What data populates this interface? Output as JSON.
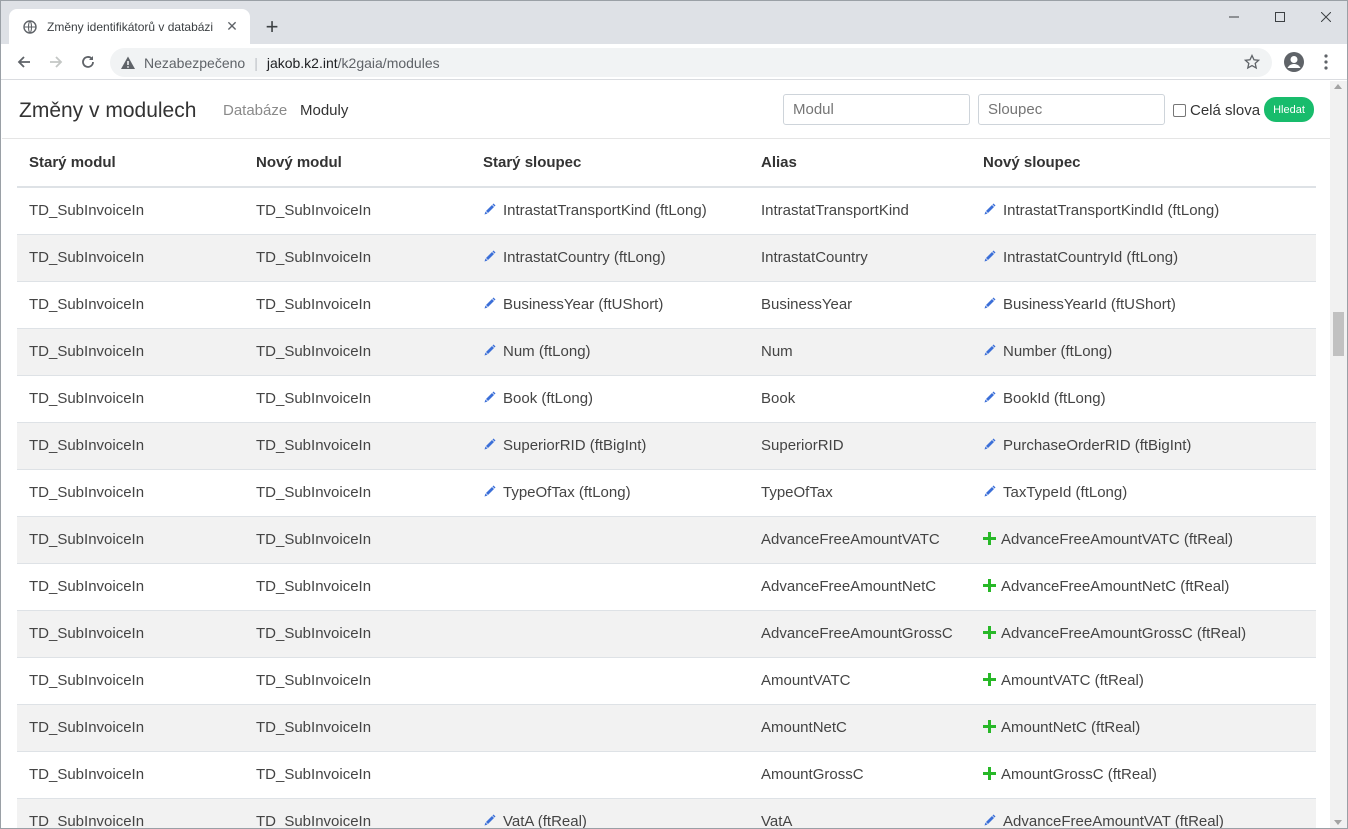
{
  "browser": {
    "tab_title": "Změny identifikátorů v databázi",
    "omnibox": {
      "security": "Nezabezpečeno",
      "host": "jakob.k2.int",
      "path": "/k2gaia/modules"
    }
  },
  "navbar": {
    "brand": "Změny v modulech",
    "links": {
      "databases": "Databáze",
      "modules": "Moduly"
    },
    "search_module_placeholder": "Modul",
    "search_column_placeholder": "Sloupec",
    "whole_words_label": "Celá slova",
    "search_button": "Hledat"
  },
  "table": {
    "headers": {
      "old_module": "Starý modul",
      "new_module": "Nový modul",
      "old_column": "Starý sloupec",
      "alias": "Alias",
      "new_column": "Nový sloupec"
    },
    "rows": [
      {
        "old_module": "TD_SubInvoiceIn",
        "new_module": "TD_SubInvoiceIn",
        "old_column": "IntrastatTransportKind (ftLong)",
        "alias": "IntrastatTransportKind",
        "new_column": "IntrastatTransportKindId (ftLong)",
        "change": "edit"
      },
      {
        "old_module": "TD_SubInvoiceIn",
        "new_module": "TD_SubInvoiceIn",
        "old_column": "IntrastatCountry (ftLong)",
        "alias": "IntrastatCountry",
        "new_column": "IntrastatCountryId (ftLong)",
        "change": "edit"
      },
      {
        "old_module": "TD_SubInvoiceIn",
        "new_module": "TD_SubInvoiceIn",
        "old_column": "BusinessYear (ftUShort)",
        "alias": "BusinessYear",
        "new_column": "BusinessYearId (ftUShort)",
        "change": "edit"
      },
      {
        "old_module": "TD_SubInvoiceIn",
        "new_module": "TD_SubInvoiceIn",
        "old_column": "Num (ftLong)",
        "alias": "Num",
        "new_column": "Number (ftLong)",
        "change": "edit"
      },
      {
        "old_module": "TD_SubInvoiceIn",
        "new_module": "TD_SubInvoiceIn",
        "old_column": "Book (ftLong)",
        "alias": "Book",
        "new_column": "BookId (ftLong)",
        "change": "edit"
      },
      {
        "old_module": "TD_SubInvoiceIn",
        "new_module": "TD_SubInvoiceIn",
        "old_column": "SuperiorRID (ftBigInt)",
        "alias": "SuperiorRID",
        "new_column": "PurchaseOrderRID (ftBigInt)",
        "change": "edit"
      },
      {
        "old_module": "TD_SubInvoiceIn",
        "new_module": "TD_SubInvoiceIn",
        "old_column": "TypeOfTax (ftLong)",
        "alias": "TypeOfTax",
        "new_column": "TaxTypeId (ftLong)",
        "change": "edit"
      },
      {
        "old_module": "TD_SubInvoiceIn",
        "new_module": "TD_SubInvoiceIn",
        "old_column": "",
        "alias": "AdvanceFreeAmountVATC",
        "new_column": "AdvanceFreeAmountVATC (ftReal)",
        "change": "add"
      },
      {
        "old_module": "TD_SubInvoiceIn",
        "new_module": "TD_SubInvoiceIn",
        "old_column": "",
        "alias": "AdvanceFreeAmountNetC",
        "new_column": "AdvanceFreeAmountNetC (ftReal)",
        "change": "add"
      },
      {
        "old_module": "TD_SubInvoiceIn",
        "new_module": "TD_SubInvoiceIn",
        "old_column": "",
        "alias": "AdvanceFreeAmountGrossC",
        "new_column": "AdvanceFreeAmountGrossC (ftReal)",
        "change": "add"
      },
      {
        "old_module": "TD_SubInvoiceIn",
        "new_module": "TD_SubInvoiceIn",
        "old_column": "",
        "alias": "AmountVATC",
        "new_column": "AmountVATC (ftReal)",
        "change": "add"
      },
      {
        "old_module": "TD_SubInvoiceIn",
        "new_module": "TD_SubInvoiceIn",
        "old_column": "",
        "alias": "AmountNetC",
        "new_column": "AmountNetC (ftReal)",
        "change": "add"
      },
      {
        "old_module": "TD_SubInvoiceIn",
        "new_module": "TD_SubInvoiceIn",
        "old_column": "",
        "alias": "AmountGrossC",
        "new_column": "AmountGrossC (ftReal)",
        "change": "add"
      },
      {
        "old_module": "TD_SubInvoiceIn",
        "new_module": "TD_SubInvoiceIn",
        "old_column": "VatA (ftReal)",
        "alias": "VatA",
        "new_column": "AdvanceFreeAmountVAT (ftReal)",
        "change": "edit"
      }
    ]
  },
  "colors": {
    "edit_icon": "#3b6fd8",
    "add_icon": "#28b828",
    "search_button": "#18bc6c",
    "row_stripe": "#f2f2f2"
  }
}
